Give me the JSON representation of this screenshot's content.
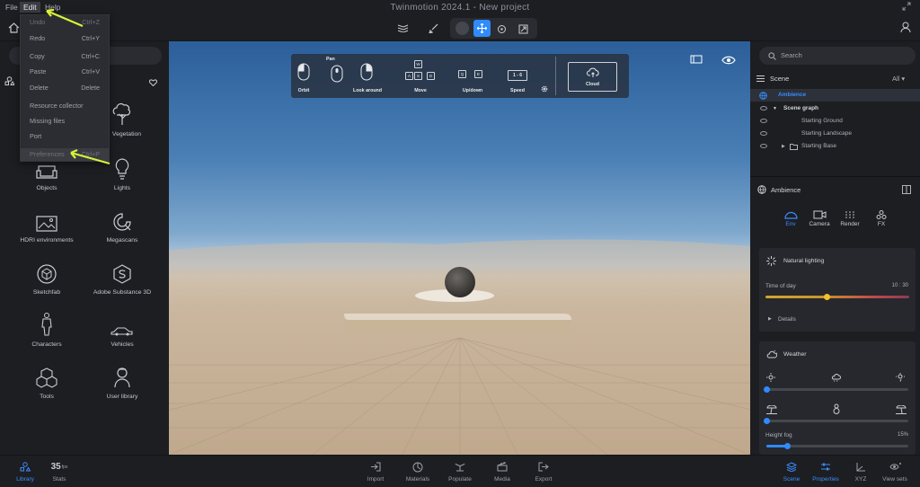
{
  "app": {
    "title": "Twinmotion 2024.1 - New project"
  },
  "menubar": {
    "file": "File",
    "edit": "Edit",
    "help": "Help"
  },
  "edit_menu": {
    "items": [
      {
        "label": "Undo",
        "shortcut": "Ctrl+Z"
      },
      {
        "label": "Redo",
        "shortcut": "Ctrl+Y"
      },
      {
        "label": "Copy",
        "shortcut": "Ctrl+C"
      },
      {
        "label": "Paste",
        "shortcut": "Ctrl+V"
      },
      {
        "label": "Delete",
        "shortcut": "Delete"
      },
      {
        "label": "Resource collector",
        "shortcut": ""
      },
      {
        "label": "Missing files",
        "shortcut": ""
      },
      {
        "label": "Port",
        "shortcut": ""
      },
      {
        "label": "Preferences",
        "shortcut": "Ctrl+P"
      }
    ]
  },
  "library": {
    "items": [
      {
        "label": "Vegetation",
        "icon": "tree-icon"
      },
      {
        "label": "Objects",
        "icon": "sofa-icon"
      },
      {
        "label": "Lights",
        "icon": "bulb-icon"
      },
      {
        "label": "HDRI environments",
        "icon": "image-icon"
      },
      {
        "label": "Megascans",
        "icon": "megascans-icon"
      },
      {
        "label": "Sketchfab",
        "icon": "cube-icon"
      },
      {
        "label": "Adobe Substance 3D",
        "icon": "substance-icon"
      },
      {
        "label": "Characters",
        "icon": "person-icon"
      },
      {
        "label": "Vehicles",
        "icon": "car-icon"
      },
      {
        "label": "Tools",
        "icon": "cubes-icon"
      },
      {
        "label": "User library",
        "icon": "user-icon"
      }
    ]
  },
  "nav_help": {
    "orbit": "Orbit",
    "pan": "Pan",
    "look_around": "Look around",
    "move": "Move",
    "updown": "Up/down",
    "speed": "Speed",
    "speed_keys": "1 - 6",
    "cloud": "Cloud",
    "move_keys": [
      "W",
      "A",
      "S",
      "D"
    ],
    "updown_keys": [
      "Q",
      "E"
    ]
  },
  "right": {
    "search_placeholder": "Search",
    "scene_title": "Scene",
    "scene_filter": "All",
    "ambience_row": "Ambience",
    "scene_graph": "Scene graph",
    "nodes": [
      "Starting Ground",
      "Starting Landscape",
      "Starting Base"
    ],
    "ambience_title": "Ambience",
    "tabs": [
      "Env",
      "Camera",
      "Render",
      "FX"
    ],
    "natural_lighting": "Natural lighting",
    "time_of_day": "Time of day",
    "time_value": "10 : 30",
    "time_fraction": 0.43,
    "details": "Details",
    "weather": "Weather",
    "height_fog": "Height fog",
    "height_fog_value": "15%",
    "height_fog_fraction": 0.15,
    "weather_slider1": 0.0,
    "weather_slider2": 0.0
  },
  "bottom": {
    "left": [
      {
        "label": "Library"
      },
      {
        "label": "Stats",
        "value": "35",
        "unit": "fps"
      }
    ],
    "center": [
      "Import",
      "Materials",
      "Populate",
      "Media",
      "Export"
    ],
    "right": [
      "Scene",
      "Properties",
      "XYZ",
      "View sets"
    ]
  },
  "colors": {
    "accent": "#2f8bff",
    "highlight_arrow": "#d9f23a",
    "panel": "#1d1e22"
  }
}
